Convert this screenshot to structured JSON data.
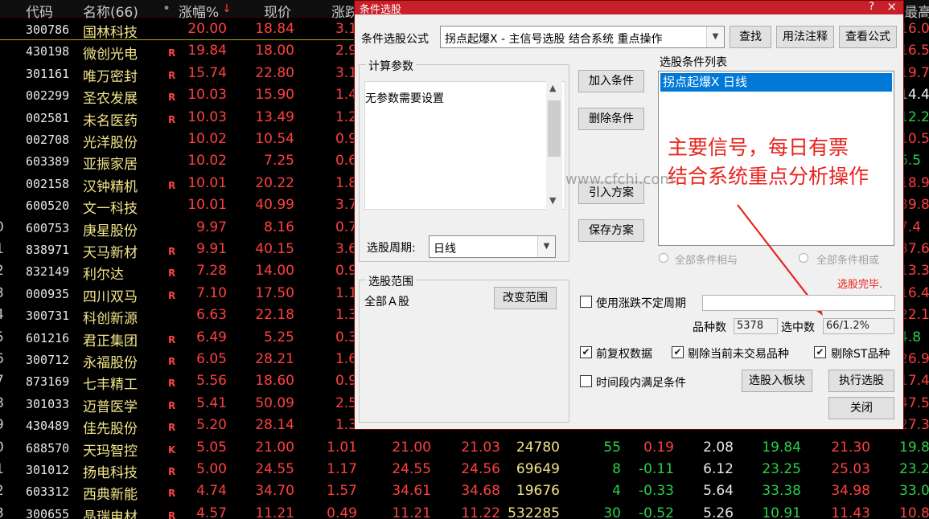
{
  "table": {
    "headers": {
      "code": "代码",
      "name": "名称(66)",
      "dot": "•",
      "pct": "涨幅%",
      "sort_arrow": "↓",
      "price": "现价",
      "chg": "涨跌",
      "max": "最高"
    },
    "rows": [
      {
        "idx": "",
        "code": "300786",
        "name": "国林科技",
        "flag": "",
        "pct": "20.00",
        "price": "18.84",
        "chg": "3.1",
        "v1": "",
        "v2": "",
        "vol": "",
        "cur": "",
        "sp": "",
        "tr": "",
        "lo": "",
        "hi": "",
        "max": "16.0"
      },
      {
        "idx": "",
        "code": "430198",
        "name": "微创光电",
        "flag": "R",
        "pct": "19.84",
        "price": "18.00",
        "chg": "2.9",
        "v1": "",
        "v2": "",
        "vol": "",
        "cur": "",
        "sp": "",
        "tr": "",
        "lo": "",
        "hi": "",
        "max": "16.5"
      },
      {
        "idx": "",
        "code": "301161",
        "name": "唯万密封",
        "flag": "R",
        "pct": "15.74",
        "price": "22.80",
        "chg": "3.1",
        "v1": "",
        "v2": "",
        "vol": "",
        "cur": "",
        "sp": "",
        "tr": "",
        "lo": "",
        "hi": "",
        "max": "19.7"
      },
      {
        "idx": "",
        "code": "002299",
        "name": "圣农发展",
        "flag": "R",
        "pct": "10.03",
        "price": "15.90",
        "chg": "1.4",
        "v1": "",
        "v2": "",
        "vol": "",
        "cur": "",
        "sp": "",
        "tr": "",
        "lo": "",
        "hi": "",
        "max": "14.4"
      },
      {
        "idx": "",
        "code": "002581",
        "name": "未名医药",
        "flag": "R",
        "pct": "10.03",
        "price": "13.49",
        "chg": "1.2",
        "v1": "",
        "v2": "",
        "vol": "",
        "cur": "",
        "sp": "",
        "tr": "",
        "lo": "",
        "hi": "",
        "max": "12.2"
      },
      {
        "idx": "",
        "code": "002708",
        "name": "光洋股份",
        "flag": "",
        "pct": "10.02",
        "price": "10.54",
        "chg": "0.9",
        "v1": "",
        "v2": "",
        "vol": "",
        "cur": "",
        "sp": "",
        "tr": "",
        "lo": "",
        "hi": "",
        "max": "10.5"
      },
      {
        "idx": "",
        "code": "603389",
        "name": "亚振家居",
        "flag": "",
        "pct": "10.02",
        "price": "7.25",
        "chg": "0.6",
        "v1": "",
        "v2": "",
        "vol": "",
        "cur": "",
        "sp": "",
        "tr": "",
        "lo": "",
        "hi": "",
        "max": "6.5"
      },
      {
        "idx": "",
        "code": "002158",
        "name": "汉钟精机",
        "flag": "R",
        "pct": "10.01",
        "price": "20.22",
        "chg": "1.8",
        "v1": "",
        "v2": "",
        "vol": "",
        "cur": "",
        "sp": "",
        "tr": "",
        "lo": "",
        "hi": "",
        "max": "18.9"
      },
      {
        "idx": "",
        "code": "600520",
        "name": "文一科技",
        "flag": "",
        "pct": "10.01",
        "price": "40.99",
        "chg": "3.7",
        "v1": "",
        "v2": "",
        "vol": "",
        "cur": "",
        "sp": "",
        "tr": "",
        "lo": "",
        "hi": "",
        "max": "39.8"
      },
      {
        "idx": "0",
        "code": "600753",
        "name": "庚星股份",
        "flag": "",
        "pct": "9.97",
        "price": "8.16",
        "chg": "0.7",
        "v1": "",
        "v2": "",
        "vol": "",
        "cur": "",
        "sp": "",
        "tr": "",
        "lo": "",
        "hi": "",
        "max": "7.4"
      },
      {
        "idx": "1",
        "code": "838971",
        "name": "天马新材",
        "flag": "R",
        "pct": "9.91",
        "price": "40.15",
        "chg": "3.6",
        "v1": "",
        "v2": "",
        "vol": "",
        "cur": "",
        "sp": "",
        "tr": "",
        "lo": "",
        "hi": "",
        "max": "37.6"
      },
      {
        "idx": "2",
        "code": "832149",
        "name": "利尔达",
        "flag": "R",
        "pct": "7.28",
        "price": "14.00",
        "chg": "0.9",
        "v1": "",
        "v2": "",
        "vol": "",
        "cur": "",
        "sp": "",
        "tr": "",
        "lo": "",
        "hi": "",
        "max": "13.3"
      },
      {
        "idx": "3",
        "code": "000935",
        "name": "四川双马",
        "flag": "R",
        "pct": "7.10",
        "price": "17.50",
        "chg": "1.1",
        "v1": "",
        "v2": "",
        "vol": "",
        "cur": "",
        "sp": "",
        "tr": "",
        "lo": "",
        "hi": "",
        "max": "16.4"
      },
      {
        "idx": "4",
        "code": "300731",
        "name": "科创新源",
        "flag": "",
        "pct": "6.63",
        "price": "22.18",
        "chg": "1.3",
        "v1": "",
        "v2": "",
        "vol": "",
        "cur": "",
        "sp": "",
        "tr": "",
        "lo": "",
        "hi": "",
        "max": "22.1"
      },
      {
        "idx": "5",
        "code": "601216",
        "name": "君正集团",
        "flag": "R",
        "pct": "6.49",
        "price": "5.25",
        "chg": "0.3",
        "v1": "",
        "v2": "",
        "vol": "",
        "cur": "",
        "sp": "",
        "tr": "",
        "lo": "",
        "hi": "",
        "max": "4.8"
      },
      {
        "idx": "6",
        "code": "300712",
        "name": "永福股份",
        "flag": "R",
        "pct": "6.05",
        "price": "28.21",
        "chg": "1.6",
        "v1": "",
        "v2": "",
        "vol": "",
        "cur": "",
        "sp": "",
        "tr": "",
        "lo": "",
        "hi": "",
        "max": "26.9"
      },
      {
        "idx": "7",
        "code": "873169",
        "name": "七丰精工",
        "flag": "R",
        "pct": "5.56",
        "price": "18.60",
        "chg": "0.9",
        "v1": "",
        "v2": "",
        "vol": "",
        "cur": "",
        "sp": "",
        "tr": "",
        "lo": "",
        "hi": "",
        "max": "17.4"
      },
      {
        "idx": "8",
        "code": "301033",
        "name": "迈普医学",
        "flag": "R",
        "pct": "5.41",
        "price": "50.09",
        "chg": "2.5",
        "v1": "",
        "v2": "",
        "vol": "",
        "cur": "",
        "sp": "",
        "tr": "",
        "lo": "",
        "hi": "",
        "max": "47.5"
      },
      {
        "idx": "9",
        "code": "430489",
        "name": "佳先股份",
        "flag": "R",
        "pct": "5.20",
        "price": "28.14",
        "chg": "1.3",
        "v1": "",
        "v2": "",
        "vol": "",
        "cur": "",
        "sp": "",
        "tr": "",
        "lo": "",
        "hi": "",
        "max": "27.3"
      },
      {
        "idx": "0",
        "code": "688570",
        "name": "天玛智控",
        "flag": "K",
        "pct": "5.05",
        "price": "21.00",
        "chg": "1.01",
        "v1": "21.00",
        "v2": "21.03",
        "vol": "24780",
        "cur": "55",
        "sp": "0.19",
        "tr": "2.08",
        "lo": "19.84",
        "hi": "21.30",
        "max": "19.8"
      },
      {
        "idx": "1",
        "code": "301012",
        "name": "扬电科技",
        "flag": "R",
        "pct": "5.00",
        "price": "24.55",
        "chg": "1.17",
        "v1": "24.55",
        "v2": "24.56",
        "vol": "69649",
        "cur": "8",
        "sp": "-0.11",
        "tr": "6.12",
        "lo": "23.25",
        "hi": "25.03",
        "max": "23.2"
      },
      {
        "idx": "2",
        "code": "603312",
        "name": "西典新能",
        "flag": "R",
        "pct": "4.74",
        "price": "34.70",
        "chg": "1.57",
        "v1": "34.61",
        "v2": "34.68",
        "vol": "19676",
        "cur": "4",
        "sp": "-0.33",
        "tr": "5.64",
        "lo": "33.38",
        "hi": "34.98",
        "max": "33.0"
      },
      {
        "idx": "3",
        "code": "300655",
        "name": "晶瑞电材",
        "flag": "R",
        "pct": "4.57",
        "price": "11.21",
        "chg": "0.49",
        "v1": "11.21",
        "v2": "11.22",
        "vol": "532285",
        "cur": "30",
        "sp": "-0.52",
        "tr": "5.26",
        "lo": "10.91",
        "hi": "11.43",
        "max": "10.8"
      }
    ]
  },
  "dialog": {
    "title": "条件选股",
    "help_glyph": "?",
    "close_glyph": "×",
    "formula_label": "条件选股公式",
    "formula_value": "拐点起爆X  -  主信号选股 结合系统 重点操作",
    "btn_find": "查找",
    "btn_usage": "用法注释",
    "btn_view": "查看公式",
    "params_group": "计算参数",
    "params_text": "无参数需要设置",
    "period_label": "选股周期:",
    "period_value": "日线",
    "btn_add": "加入条件",
    "btn_delete": "删除条件",
    "btn_import": "引入方案",
    "btn_save": "保存方案",
    "cond_list_label": "选股条件列表",
    "cond_item": "拐点起爆X  日线",
    "radio_and": "全部条件相与",
    "radio_or": "全部条件相或",
    "done_text": "选股完毕.",
    "scope_group": "选股范围",
    "scope_value": "全部Ａ股",
    "btn_change_scope": "改变范围",
    "chk_period_label": "使用涨跌不定周期",
    "count_label": "品种数",
    "count_value": "5378",
    "selected_label": "选中数",
    "selected_value": "66/1.2%",
    "chk_adjust_label": "前复权数据",
    "chk_exclude_label": "剔除当前未交易品种",
    "chk_st_label": "剔除ST品种",
    "chk_time_label": "时间段内满足条件",
    "btn_to_block": "选股入板块",
    "btn_execute": "执行选股",
    "btn_close": "关闭",
    "annotation_line1": "主要信号，每日有票",
    "annotation_line2": "结合系统重点分析操作",
    "watermark": "www.cfchi.com"
  },
  "colors": {
    "background": "#000000",
    "title_bar": "#c8202a",
    "up_red": "#ff4040",
    "down_green": "#2ad04a",
    "name_yellow": "#f2e48a",
    "annotation_red": "#e8231d",
    "selection_blue": "#0078d7"
  },
  "icons": {
    "combo_arrow": "chevron-down-icon",
    "scroll_up": "arrow-up-icon",
    "scroll_down": "arrow-down-icon",
    "checked": "checkmark-icon",
    "pointer": "red-arrow-icon"
  }
}
